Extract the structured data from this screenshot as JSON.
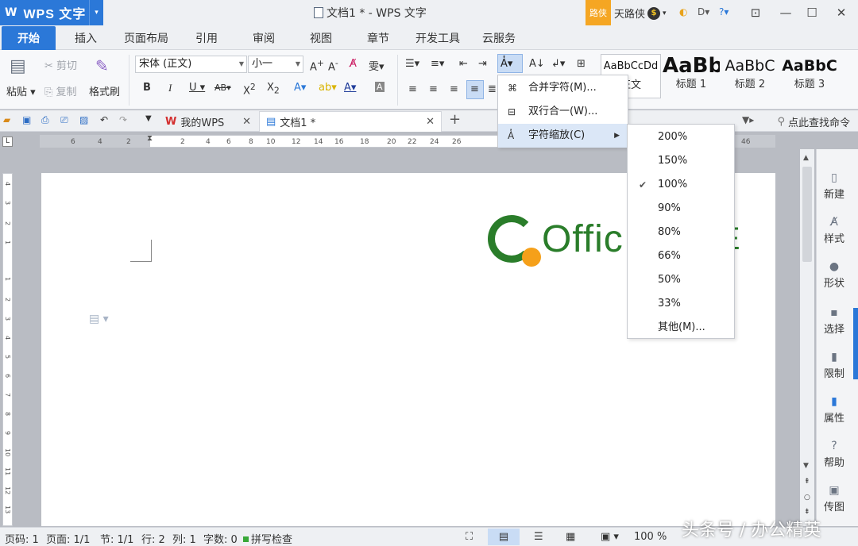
{
  "titlebar": {
    "app_name": "WPS 文字",
    "logo_mark": "W",
    "window_title": "文档1 * - WPS 文字",
    "user_badge": "路侠",
    "user_name": "天路侠",
    "coin": "$"
  },
  "ribbon_tabs": [
    "开始",
    "插入",
    "页面布局",
    "引用",
    "审阅",
    "视图",
    "章节",
    "开发工具",
    "云服务"
  ],
  "ribbon": {
    "paste": "粘贴",
    "cut": "剪切",
    "copy": "复制",
    "format_painter": "格式刷",
    "font_name": "宋体 (正文)",
    "font_size": "小一",
    "styles": [
      {
        "sample": "AaBbCcDd",
        "name": "正文"
      },
      {
        "sample": "AaBb",
        "name": "标题 1"
      },
      {
        "sample": "AaBbC",
        "name": "标题 2"
      },
      {
        "sample": "AaBbC",
        "name": "标题 3"
      }
    ]
  },
  "doc_tabs": {
    "my_wps": "我的WPS",
    "doc1": "文档1 *",
    "search_command": "点此查找命令"
  },
  "hruler_ticks": [
    "6",
    "4",
    "2",
    "2",
    "4",
    "6",
    "8",
    "10",
    "12",
    "14",
    "16",
    "18",
    "20",
    "22",
    "24",
    "26",
    "46"
  ],
  "vruler_ticks": [
    "4",
    "3",
    "2",
    "1",
    "1",
    "2",
    "3",
    "4",
    "5",
    "6",
    "7",
    "8",
    "9",
    "10",
    "11",
    "12",
    "13"
  ],
  "page": {
    "logo_text": "Offic",
    "logo_tail": "E"
  },
  "task_pane": [
    "新建",
    "样式",
    "形状",
    "选择",
    "限制",
    "属性",
    "帮助",
    "传图"
  ],
  "menu_char": {
    "items": [
      {
        "label": "合并字符(M)..."
      },
      {
        "label": "双行合一(W)..."
      },
      {
        "label": "字符缩放(C)"
      }
    ]
  },
  "menu_scale": {
    "items": [
      "200%",
      "150%",
      "100%",
      "90%",
      "80%",
      "66%",
      "50%",
      "33%",
      "其他(M)..."
    ],
    "checked": "100%"
  },
  "statusbar": {
    "page_no": "页码: 1",
    "pages": "页面: 1/1",
    "section": "节: 1/1",
    "row": "行: 2",
    "col": "列: 1",
    "word_count": "字数: 0",
    "spell_check": "拼写检查",
    "zoom": "100 %"
  },
  "watermark": "头条号 / 办公精英"
}
